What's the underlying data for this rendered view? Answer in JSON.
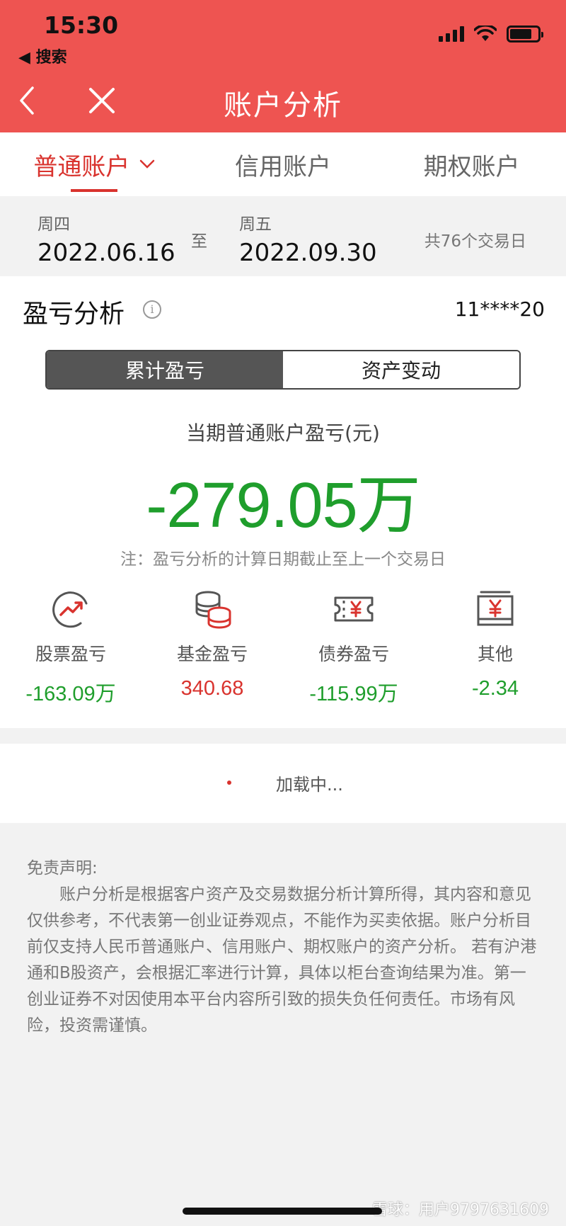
{
  "status_bar": {
    "time": "15:30",
    "back_app": "◀ 搜索"
  },
  "nav": {
    "title": "账户分析"
  },
  "tabs": [
    {
      "label": "普通账户",
      "active": true
    },
    {
      "label": "信用账户",
      "active": false
    },
    {
      "label": "期权账户",
      "active": false
    }
  ],
  "date_range": {
    "start_dow": "周四",
    "start_date": "2022.06.16",
    "to": "至",
    "end_dow": "周五",
    "end_date": "2022.09.30",
    "trade_days": "共76个交易日"
  },
  "pl_section": {
    "title": "盈亏分析",
    "info_icon": "i",
    "account": "11****20",
    "segments": [
      "累计盈亏",
      "资产变动"
    ],
    "active_segment": 0,
    "label": "当期普通账户盈亏(元)",
    "value": "-279.05万",
    "note": "注：盈亏分析的计算日期截止至上一个交易日",
    "categories": [
      {
        "name": "股票盈亏",
        "value": "-163.09万",
        "icon": "trend-up-icon",
        "color": "green"
      },
      {
        "name": "基金盈亏",
        "value": "340.68",
        "icon": "coins-icon",
        "color": "red"
      },
      {
        "name": "债券盈亏",
        "value": "-115.99万",
        "icon": "ticket-yen-icon",
        "color": "green"
      },
      {
        "name": "其他",
        "value": "-2.34",
        "icon": "yen-box-icon",
        "color": "green"
      }
    ]
  },
  "loading": {
    "text": "加载中..."
  },
  "disclaimer": {
    "title": "免责声明:",
    "body": "账户分析是根据客户资产及交易数据分析计算所得，其内容和意见仅供参考，不代表第一创业证券观点，不能作为买卖依据。账户分析目前仅支持人民币普通账户、信用账户、期权账户的资产分析。 若有沪港通和B股资产，会根据汇率进行计算，具体以柜台查询结果为准。第一创业证券不对因使用本平台内容所引致的损失负任何责任。市场有风险，投资需谨慎。"
  },
  "watermark": "雪球：用户9797631609",
  "colors": {
    "header": "#ee5451",
    "accent": "#d9332e",
    "loss": "#1f9e2c"
  }
}
